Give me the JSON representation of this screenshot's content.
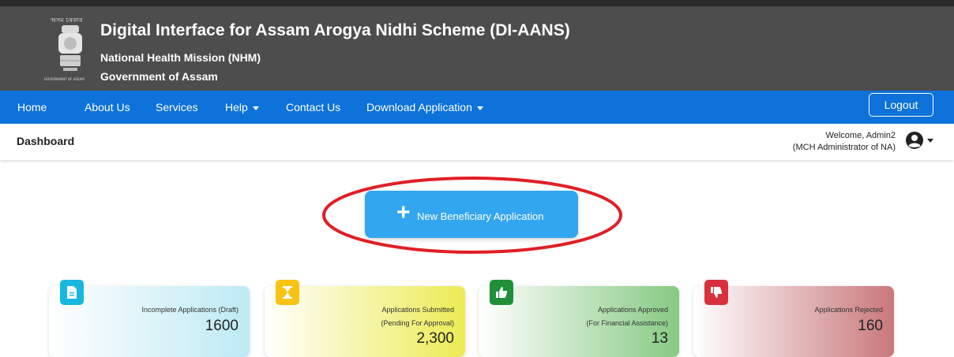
{
  "header": {
    "emblem_top_text": "অসম চৰকাৰ",
    "emblem_bottom_text": "GOVERNMENT OF ASSAM",
    "title": "Digital Interface for Assam Arogya Nidhi Scheme (DI-AANS)",
    "subtitle_1": "National Health Mission (NHM)",
    "subtitle_2": "Government of Assam"
  },
  "nav": {
    "items": [
      {
        "label": "Home"
      },
      {
        "label": "About Us"
      },
      {
        "label": "Services"
      },
      {
        "label": "Help",
        "has_dropdown": true
      },
      {
        "label": "Contact Us"
      },
      {
        "label": "Download Application",
        "has_dropdown": true
      }
    ],
    "logout_label": "Logout",
    "background_color": "#0d72d9"
  },
  "subbar": {
    "page_title": "Dashboard",
    "welcome_line_1": "Welcome, Admin2",
    "welcome_line_2": "(MCH Administrator of NA)",
    "user_icon": "user-circle-icon"
  },
  "main": {
    "new_application_button": {
      "icon": "plus-icon",
      "label": "New Beneficiary Application",
      "color": "#33a6f0"
    },
    "annotation": {
      "shape": "ellipse",
      "color": "#e01f26"
    }
  },
  "cards": [
    {
      "label_lines": [
        "Incomplete Applications (Draft)"
      ],
      "value": "1600",
      "icon": "document-icon",
      "icon_color": "#18b7e0"
    },
    {
      "label_lines": [
        "Applications Submitted",
        "(Pending For Approval)"
      ],
      "value": "2,300",
      "icon": "hourglass-icon",
      "icon_color": "#f6c315"
    },
    {
      "label_lines": [
        "Applications Approved",
        "(For Financial Assistance)"
      ],
      "value": "13",
      "icon": "thumbs-up-icon",
      "icon_color": "#1f8f3a"
    },
    {
      "label_lines": [
        "Applications Rejected"
      ],
      "value": "160",
      "icon": "thumbs-down-icon",
      "icon_color": "#d9303e"
    }
  ]
}
